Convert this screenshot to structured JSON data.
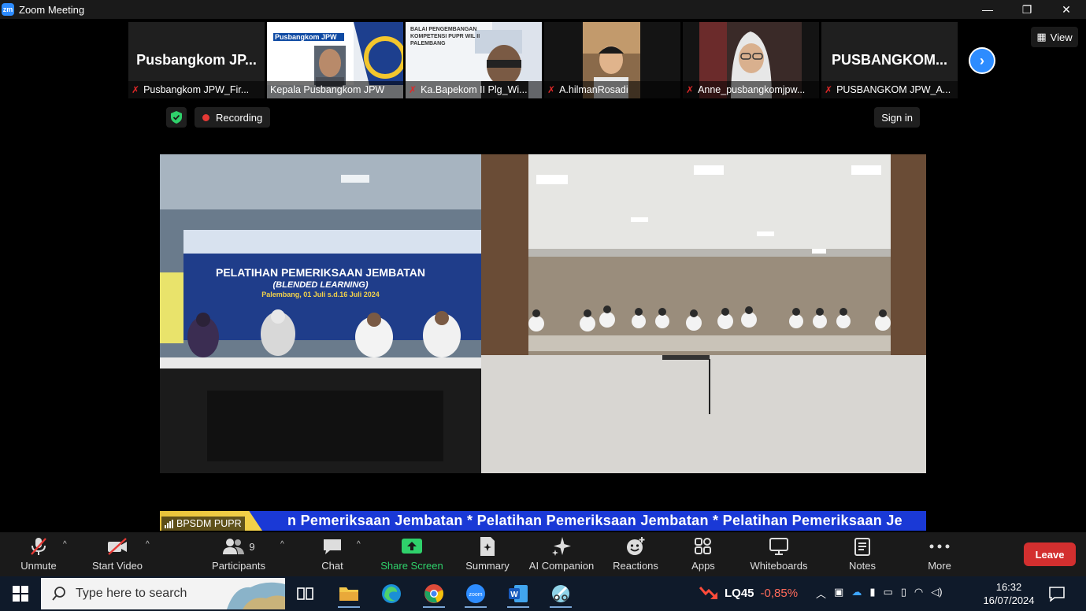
{
  "window": {
    "app_logo": "zm",
    "title": "Zoom Meeting",
    "minimize": "—",
    "restore": "❐",
    "close": "✕"
  },
  "gallery": {
    "view_label": "View",
    "next_icon": "chevron-right-icon",
    "tiles": [
      {
        "big_name": "Pusbangkom JP...",
        "name": "Pusbangkom JPW_Fir...",
        "muted": true
      },
      {
        "name": "Kepala Pusbangkom JPW",
        "muted": false
      },
      {
        "name": "Ka.Bapekom II Plg_Wi...",
        "muted": true
      },
      {
        "name": "A.hilmanRosadi",
        "muted": true
      },
      {
        "name": "Anne_pusbangkomjpw...",
        "muted": true
      },
      {
        "big_name": "PUSBANGKOM...",
        "name": "PUSBANGKOM JPW_A...",
        "muted": true
      }
    ],
    "slide_texts": {
      "t1_line1": "Pusbangkom JPW",
      "t2_line1": "BALAI PENGEMBANGAN",
      "t2_line2": "KOMPETENSI PUPR WIL II",
      "t2_line3": "PALEMBANG"
    }
  },
  "stage": {
    "recording_label": "Recording",
    "sign_in_label": "Sign in",
    "banner_title": "PELATIHAN PEMERIKSAAN JEMBATAN",
    "banner_subtitle": "(BLENDED LEARNING)",
    "banner_date": "Palembang, 01 Juli s.d.16 Juli 2024",
    "ticker": "n Pemeriksaan Jembatan * Pelatihan Pemeriksaan Jembatan * Pelatihan Pemeriksaan Je",
    "speaker_name": "BPSDM PUPR"
  },
  "toolbar": {
    "unmute": "Unmute",
    "start_video": "Start Video",
    "participants": "Participants",
    "participants_count": "9",
    "chat": "Chat",
    "share_screen": "Share Screen",
    "summary": "Summary",
    "ai_companion": "AI Companion",
    "reactions": "Reactions",
    "apps": "Apps",
    "whiteboards": "Whiteboards",
    "notes": "Notes",
    "more": "More",
    "leave": "Leave",
    "accent_green": "#2fd16b",
    "leave_color": "#d32f2f"
  },
  "taskbar": {
    "search_placeholder": "Type here to search",
    "stock_symbol": "LQ45",
    "stock_change": "-0,85%",
    "time": "16:32",
    "date": "16/07/2024"
  }
}
